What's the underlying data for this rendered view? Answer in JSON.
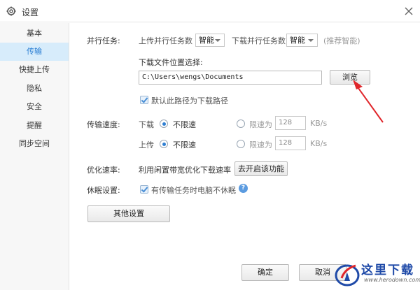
{
  "window": {
    "title": "设置",
    "icon": "gear-icon",
    "close_icon": "close-icon"
  },
  "sidebar": {
    "items": [
      {
        "label": "基本",
        "active": false
      },
      {
        "label": "传输",
        "active": true
      },
      {
        "label": "快捷上传",
        "active": false
      },
      {
        "label": "隐私",
        "active": false
      },
      {
        "label": "安全",
        "active": false
      },
      {
        "label": "提醒",
        "active": false
      },
      {
        "label": "同步空间",
        "active": false
      }
    ]
  },
  "parallel": {
    "label": "并行任务:",
    "upload_label": "上传并行任务数",
    "upload_value": "智能",
    "download_label": "下载并行任务数",
    "download_value": "智能",
    "hint": "(推荐智能)"
  },
  "download_location": {
    "label": "下载文件位置选择:",
    "path": "C:\\Users\\wengs\\Documents",
    "browse_label": "浏览",
    "default_checkbox_label": "默认此路径为下载路径",
    "default_checked": true
  },
  "speed": {
    "label": "传输速度:",
    "download": {
      "label": "下载",
      "unlimited_label": "不限速",
      "limit_label": "限速为",
      "limit_value": "128",
      "unit": "KB/s",
      "selected": "unlimited"
    },
    "upload": {
      "label": "上传",
      "unlimited_label": "不限速",
      "limit_label": "限速为",
      "limit_value": "128",
      "unit": "KB/s",
      "selected": "unlimited"
    }
  },
  "optimize": {
    "label": "优化速率:",
    "text": "利用闲置带宽优化下载速率",
    "button_label": "去开启该功能"
  },
  "sleep": {
    "label": "休眠设置:",
    "checkbox_label": "有传输任务时电脑不休眠",
    "checked": true,
    "help_icon": "help-icon",
    "help_glyph": "?"
  },
  "other_settings_label": "其他设置",
  "footer": {
    "ok_label": "确定",
    "cancel_label": "取消"
  },
  "watermark": {
    "text": "这里下载",
    "url": "www.herodown.com"
  },
  "colors": {
    "accent": "#2a7ed3",
    "active_bg": "#d7ecfb",
    "annotation_arrow": "#e0262b"
  }
}
